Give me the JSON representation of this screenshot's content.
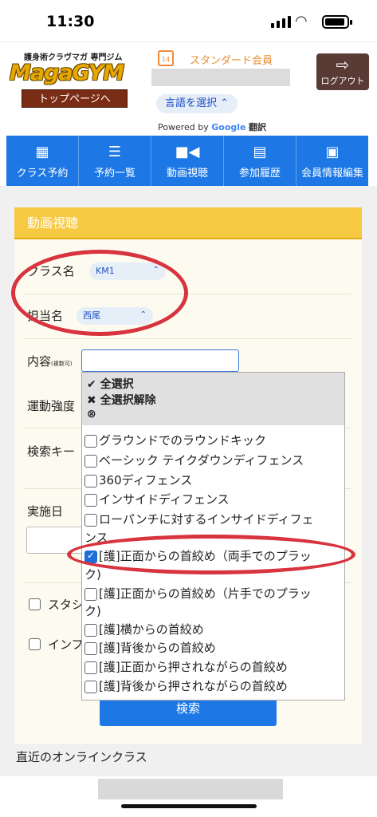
{
  "status": {
    "time": "11:30"
  },
  "header": {
    "logo_sub": "護身術クラヴマガ 専門ジム",
    "logo_main": "MagaGYM",
    "top_link": "トップページへ",
    "calendar_day": "14",
    "member_type": "スタンダード会員",
    "language_button": "言語を選択 ⌃",
    "powered_by": "Powered by",
    "google": "Google",
    "translate": "翻訳",
    "logout": "ログアウト"
  },
  "nav": [
    {
      "label": "クラス予約",
      "icon": "calendar-check-icon"
    },
    {
      "label": "予約一覧",
      "icon": "list-icon"
    },
    {
      "label": "動画視聴",
      "icon": "video-camera-icon"
    },
    {
      "label": "参加履歴",
      "icon": "history-list-icon"
    },
    {
      "label": "会員情報編集",
      "icon": "id-card-icon"
    }
  ],
  "panel": {
    "title": "動画視聴",
    "class_label": "クラス名",
    "class_value": "KM1",
    "instructor_label": "担当名",
    "instructor_value": "西尾",
    "content_label": "内容",
    "content_note": "(複数可)",
    "intensity_label": "運動強度",
    "keyword_label": "検索キー",
    "date_label": "実施日",
    "check1_label": "スタシ",
    "check2_label": "インフ",
    "search_button": "検索",
    "recent_label": "直近のオンラインクラス"
  },
  "dropdown": {
    "select_all": "全選択",
    "deselect_all": "全選択解除",
    "options": [
      "グラウンドでのラウンドキック",
      "ベーシック テイクダウンディフェンス",
      "360ディフェンス",
      "インサイドディフェンス",
      "ローパンチに対するインサイドディフェ",
      "ンス",
      "[護]正面からの首絞め（両手でのプラッ",
      "ク)",
      "[護]正面からの首絞め（片手でのプラッ",
      "ク)",
      "[護]横からの首絞め",
      "[護]背後からの首絞め",
      "[護]正面から押されながらの首絞め",
      "[護]背後から押されながらの首絞め"
    ]
  }
}
